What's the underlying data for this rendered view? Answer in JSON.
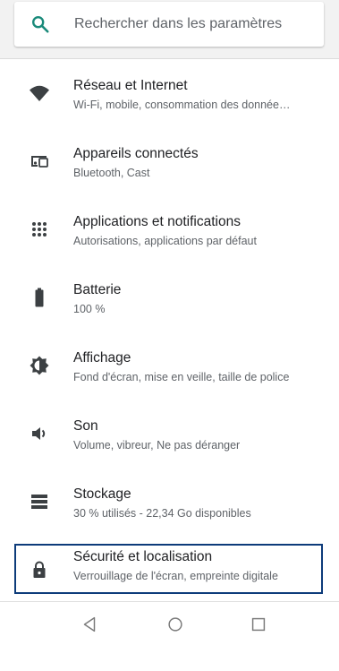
{
  "search": {
    "placeholder": "Rechercher dans les paramètres"
  },
  "colors": {
    "accent": "#1a8a7a",
    "icon": "#3c4043",
    "selection_border": "#0d3b7a"
  },
  "items": [
    {
      "icon": "wifi-icon",
      "title": "Réseau et Internet",
      "subtitle": "Wi-Fi, mobile, consommation des donnée…"
    },
    {
      "icon": "connected-devices-icon",
      "title": "Appareils connectés",
      "subtitle": "Bluetooth, Cast"
    },
    {
      "icon": "apps-grid-icon",
      "title": "Applications et notifications",
      "subtitle": "Autorisations, applications par défaut"
    },
    {
      "icon": "battery-icon",
      "title": "Batterie",
      "subtitle": "100 %"
    },
    {
      "icon": "brightness-icon",
      "title": "Affichage",
      "subtitle": "Fond d'écran, mise en veille, taille de police"
    },
    {
      "icon": "volume-icon",
      "title": "Son",
      "subtitle": "Volume, vibreur, Ne pas déranger"
    },
    {
      "icon": "storage-icon",
      "title": "Stockage",
      "subtitle": "30 % utilisés - 22,34 Go disponibles"
    },
    {
      "icon": "lock-icon",
      "title": "Sécurité et localisation",
      "subtitle": "Verrouillage de l'écran, empreinte digitale"
    }
  ],
  "navbar": {
    "buttons": [
      "back-icon",
      "home-icon",
      "recents-icon"
    ]
  }
}
